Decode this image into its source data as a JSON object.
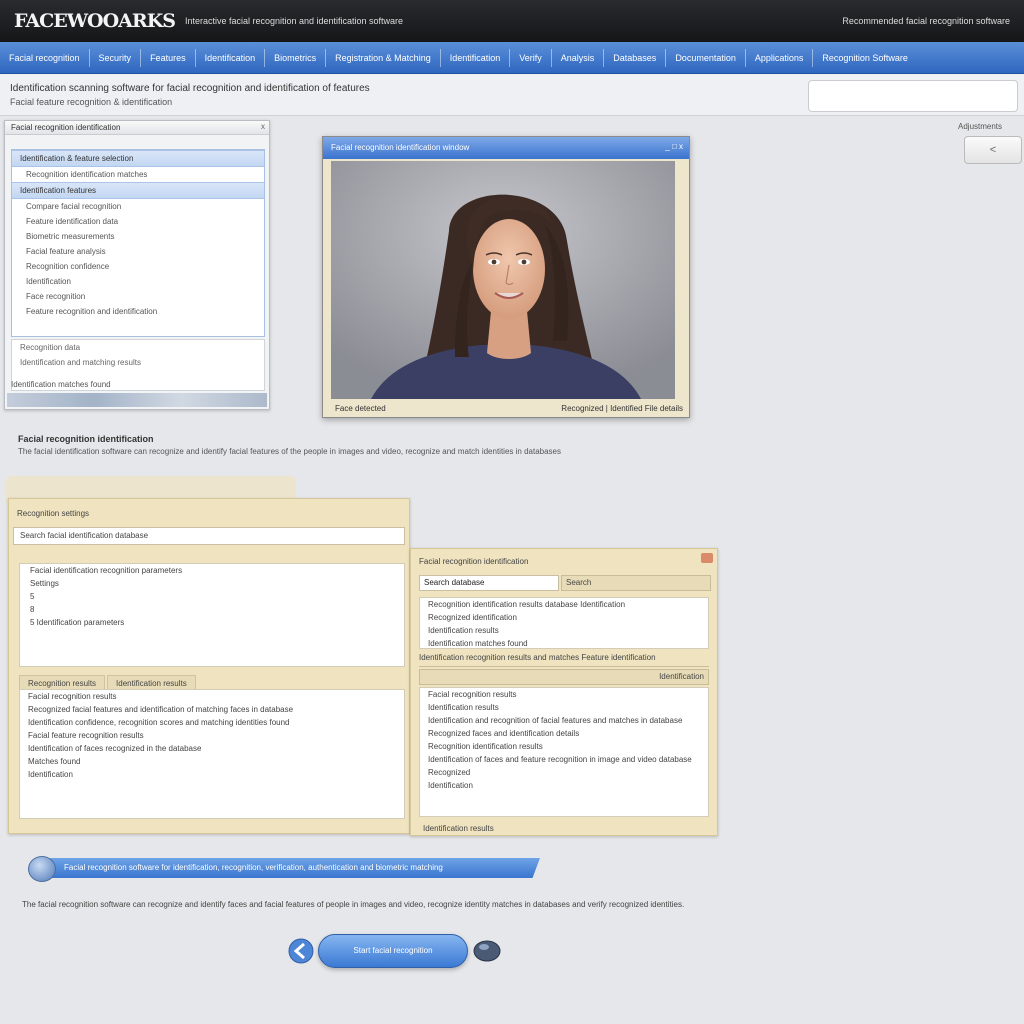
{
  "app": {
    "logo": "FACEWOOARKS",
    "tagline": "Interactive facial recognition and identification software",
    "top_right": "Recommended facial recognition software"
  },
  "nav": {
    "items": [
      "Facial recognition",
      "Security",
      "Features",
      "Identification",
      "Biometrics",
      "Registration & Matching",
      "Identification",
      "Verify",
      "Analysis",
      "Databases",
      "Documentation",
      "Applications",
      "Recognition Software"
    ]
  },
  "header": {
    "title": "Identification scanning software for facial recognition and identification of features",
    "subtitle": "Facial feature recognition & identification",
    "search_placeholder": ""
  },
  "side": {
    "label": "Adjustments",
    "button_label": "<"
  },
  "left_window": {
    "title": "Facial recognition identification",
    "close": "x",
    "selected_row": "Identification & feature selection",
    "rows_top": [
      "Recognition identification matches"
    ],
    "selected_row_2": "Identification features",
    "rows": [
      "Compare facial recognition",
      "Feature identification data",
      "Biometric measurements",
      "Facial feature analysis",
      "Recognition confidence",
      "Identification",
      "Face recognition",
      "Feature recognition and identification"
    ],
    "bottom_rows": [
      "Recognition data",
      "Identification and matching results"
    ],
    "status": "Identification matches found"
  },
  "photo_window": {
    "title": "Facial recognition identification window",
    "controls": "_ □ x",
    "footer_left": "Face detected",
    "footer_right": "Recognized | Identified  File details"
  },
  "section": {
    "title": "Facial recognition identification",
    "description": "The facial identification software can recognize and identify facial features of the people in images and video, recognize and match identities in databases"
  },
  "form_left": {
    "title": "Recognition settings",
    "input_value": "Search facial identification database",
    "box1_lines": [
      "Facial identification recognition parameters",
      "Settings",
      "5",
      "8",
      "5  Identification parameters"
    ],
    "tabs": [
      "Recognition results",
      "Identification results"
    ],
    "box2_lines": [
      "Facial recognition results",
      "Recognized facial features and identification of matching faces in database",
      "Identification confidence, recognition scores and matching identities found",
      "Facial feature recognition results",
      "Identification of faces recognized in the database",
      "Matches found",
      "Identification"
    ]
  },
  "form_right": {
    "title": "Facial recognition identification",
    "input_value": "Search database",
    "button_label": "Search",
    "box1_lines": [
      "Recognition identification results database   Identification",
      "Recognized identification",
      "Identification results",
      "Identification matches found"
    ],
    "mid_line": "Identification recognition results and matches       Feature identification",
    "bar_label": "Identification",
    "box2_lines": [
      "Facial recognition results",
      "Identification results",
      "Identification and recognition of facial features and matches in database",
      "Recognized faces and identification details",
      "Recognition identification results",
      "Identification of faces and feature recognition in image and video database",
      "Recognized",
      "Identification"
    ],
    "footer": "Identification results"
  },
  "banner": {
    "text": "Facial recognition software for identification, recognition, verification, authentication and biometric matching"
  },
  "footer_text": "The facial recognition software can recognize and identify faces and facial features of people in images and video, recognize identity matches in databases and verify recognized identities.",
  "cta": {
    "label": "Start facial recognition"
  },
  "colors": {
    "nav_blue": "#3a72c8",
    "panel_tan": "#efe3c0",
    "topbar": "#1c1d20"
  }
}
